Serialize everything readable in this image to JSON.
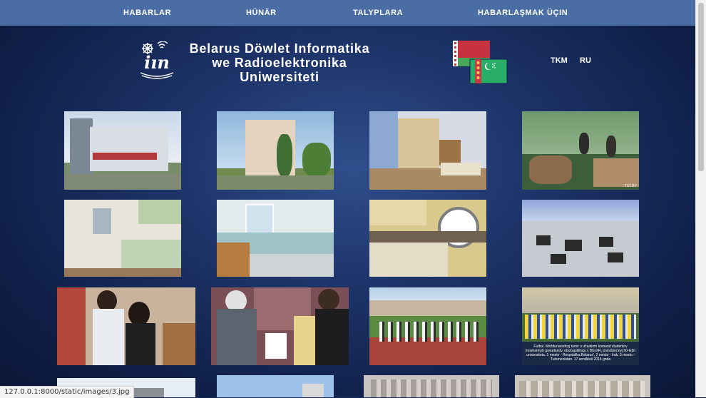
{
  "nav": {
    "items": [
      {
        "label": "HABARLAR"
      },
      {
        "label": "HÜNÄR"
      },
      {
        "label": "TALYPLARA"
      },
      {
        "label": "HABARLAŞMAK ÜÇIN"
      }
    ]
  },
  "header": {
    "title_line1": "Belarus Döwlet Informatika",
    "title_line2": "we Radioelektronika",
    "title_line3": "Uniwersiteti",
    "logo_icon": "university-logo-icon",
    "flags_icon": "belarus-turkmenistan-flags-icon"
  },
  "lang": {
    "tkm": "TKM",
    "ru": "RU"
  },
  "gallery": {
    "items": [
      {
        "name": "photo-university-campus"
      },
      {
        "name": "photo-dormitory-building"
      },
      {
        "name": "photo-dorm-room-empty"
      },
      {
        "name": "photo-students-in-room"
      },
      {
        "name": "photo-kitchen-green"
      },
      {
        "name": "photo-washroom"
      },
      {
        "name": "photo-kitchen-yellow"
      },
      {
        "name": "photo-dining-hall"
      },
      {
        "name": "photo-couple-in-room"
      },
      {
        "name": "photo-meeting-gift"
      },
      {
        "name": "photo-sports-field"
      },
      {
        "name": "photo-football-team"
      },
      {
        "name": "photo-row4-1"
      },
      {
        "name": "photo-row4-2"
      },
      {
        "name": "photo-row4-3"
      },
      {
        "name": "photo-row4-4"
      }
    ],
    "football_caption": "Futbol. Meždunarodnyj turnir s učastiem komand studentov inostrannyh gosudarstv, obučajuŝihsja v BGUIR, posvâŝennyj 50-letiû universiteta. 1 mesto - Respublika Belarus', 2 mesto - Irak, 3 mesto - Turkmenistan. 17 sentâbrâ 2014 goda",
    "watermark": "TUT.BY"
  },
  "status": {
    "url": "127.0.0.1:8000/static/images/3.jpg"
  },
  "colors": {
    "nav_bg": "#4a6ea3",
    "page_bg": "#1d3368",
    "text": "#ffffff"
  }
}
